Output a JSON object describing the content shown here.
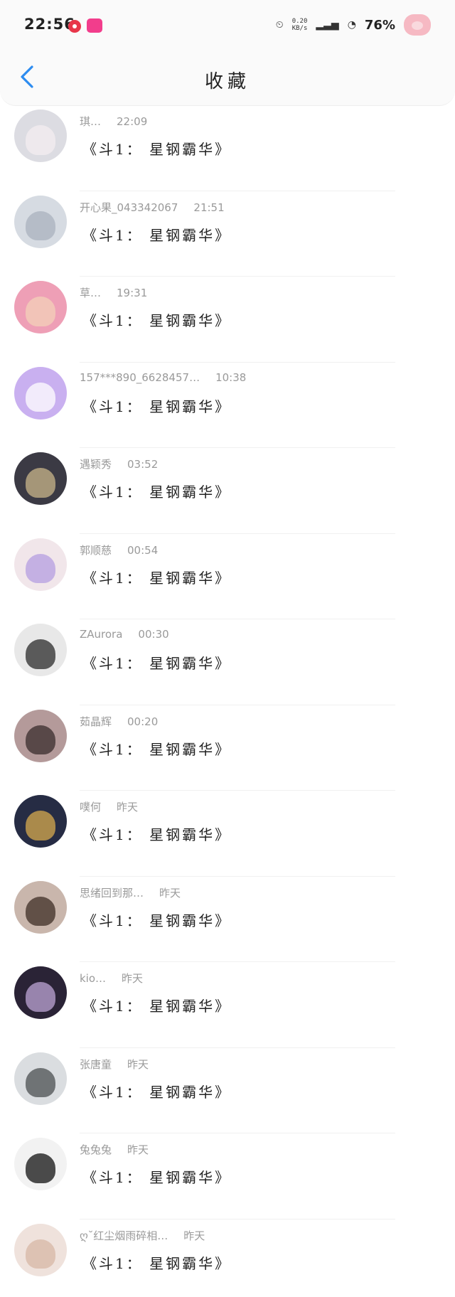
{
  "status_bar": {
    "time": "22:56",
    "net_speed_value": "0.20",
    "net_speed_unit": "KB/s",
    "battery": "76%"
  },
  "header": {
    "title": "收藏"
  },
  "items": [
    {
      "name": "琪…",
      "time": "22:09",
      "text": "《斗1： 星钢霸华》",
      "avatar_bg": "#dcdce2",
      "avatar_fg": "#f4eef0"
    },
    {
      "name": "开心果_043342067",
      "time": "21:51",
      "text": "《斗1： 星钢霸华》",
      "avatar_bg": "#d6dbe2",
      "avatar_fg": "#a9b2bd"
    },
    {
      "name": "草…",
      "time": "19:31",
      "text": "《斗1： 星钢霸华》",
      "avatar_bg": "#ee9fb6",
      "avatar_fg": "#f3d0b8"
    },
    {
      "name": "157***890_6628457…",
      "time": "10:38",
      "text": "《斗1： 星钢霸华》",
      "avatar_bg": "#c9b0f0",
      "avatar_fg": "#ffffff"
    },
    {
      "name": "遇颖秀",
      "time": "03:52",
      "text": "《斗1： 星钢霸华》",
      "avatar_bg": "#3b3a44",
      "avatar_fg": "#c9b58a"
    },
    {
      "name": "郭顺慈",
      "time": "00:54",
      "text": "《斗1： 星钢霸华》",
      "avatar_bg": "#f1e6ea",
      "avatar_fg": "#b49ee0"
    },
    {
      "name": "ZAurora",
      "time": "00:30",
      "text": "《斗1： 星钢霸华》",
      "avatar_bg": "#e8e8e8",
      "avatar_fg": "#2b2b2b"
    },
    {
      "name": "茹晶辉",
      "time": "00:20",
      "text": "《斗1： 星钢霸华》",
      "avatar_bg": "#b49a9a",
      "avatar_fg": "#3a2c2c"
    },
    {
      "name": "噗何",
      "time": "昨天",
      "text": "《斗1： 星钢霸华》",
      "avatar_bg": "#262c44",
      "avatar_fg": "#d7a94e"
    },
    {
      "name": "思绪回到那…",
      "time": "昨天",
      "text": "《斗1： 星钢霸华》",
      "avatar_bg": "#c9b6ac",
      "avatar_fg": "#3d2d25"
    },
    {
      "name": "kio…",
      "time": "昨天",
      "text": "《斗1： 星钢霸华》",
      "avatar_bg": "#2a2336",
      "avatar_fg": "#bda6d6"
    },
    {
      "name": "张唐童",
      "time": "昨天",
      "text": "《斗1： 星钢霸华》",
      "avatar_bg": "#dadde0",
      "avatar_fg": "#4b4f51"
    },
    {
      "name": "兔兔兔",
      "time": "昨天",
      "text": "《斗1： 星钢霸华》",
      "avatar_bg": "#f2f2f2",
      "avatar_fg": "#111111"
    },
    {
      "name": "ღ˘红尘烟雨碎相…",
      "time": "昨天",
      "text": "《斗1： 星钢霸华》",
      "avatar_bg": "#efe2dc",
      "avatar_fg": "#d7b7a6"
    }
  ]
}
